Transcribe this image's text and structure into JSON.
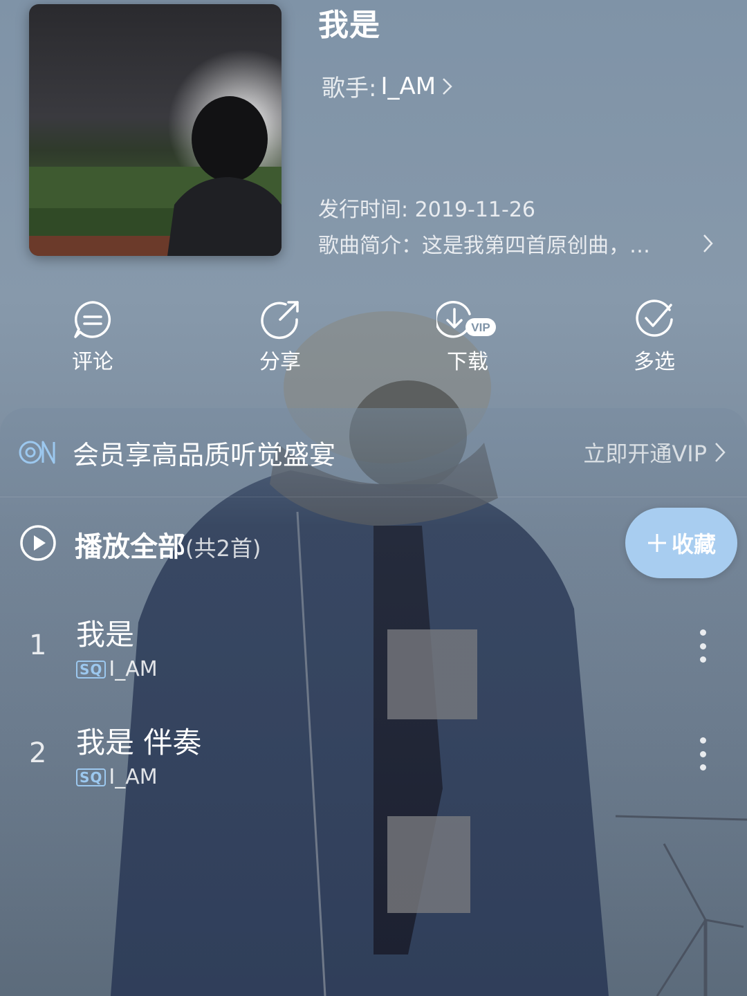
{
  "song": {
    "title": "我是",
    "singer_label": "歌手:",
    "singer": "I_AM",
    "release": "发行时间: 2019-11-26",
    "intro": "歌曲简介：这是我第四首原创曲，…"
  },
  "actions": [
    {
      "label": "评论",
      "icon": "comment-icon"
    },
    {
      "label": "分享",
      "icon": "share-icon"
    },
    {
      "label": "下载",
      "icon": "download-vip-icon",
      "badge": "VIP"
    },
    {
      "label": "多选",
      "icon": "multiselect-icon"
    }
  ],
  "vip": {
    "text": "会员享高品质听觉盛宴",
    "cta": "立即开通VIP"
  },
  "playall": {
    "label": "播放全部",
    "count": "(共2首)",
    "fav": "收藏"
  },
  "tracks": [
    {
      "index": "1",
      "name": "我是",
      "quality": "SQ",
      "artist": "I_AM"
    },
    {
      "index": "2",
      "name": "我是 伴奏",
      "quality": "SQ",
      "artist": "I_AM"
    }
  ],
  "colors": {
    "accent": "#a8cdf0",
    "sq_badge": "#9cc8ef"
  }
}
